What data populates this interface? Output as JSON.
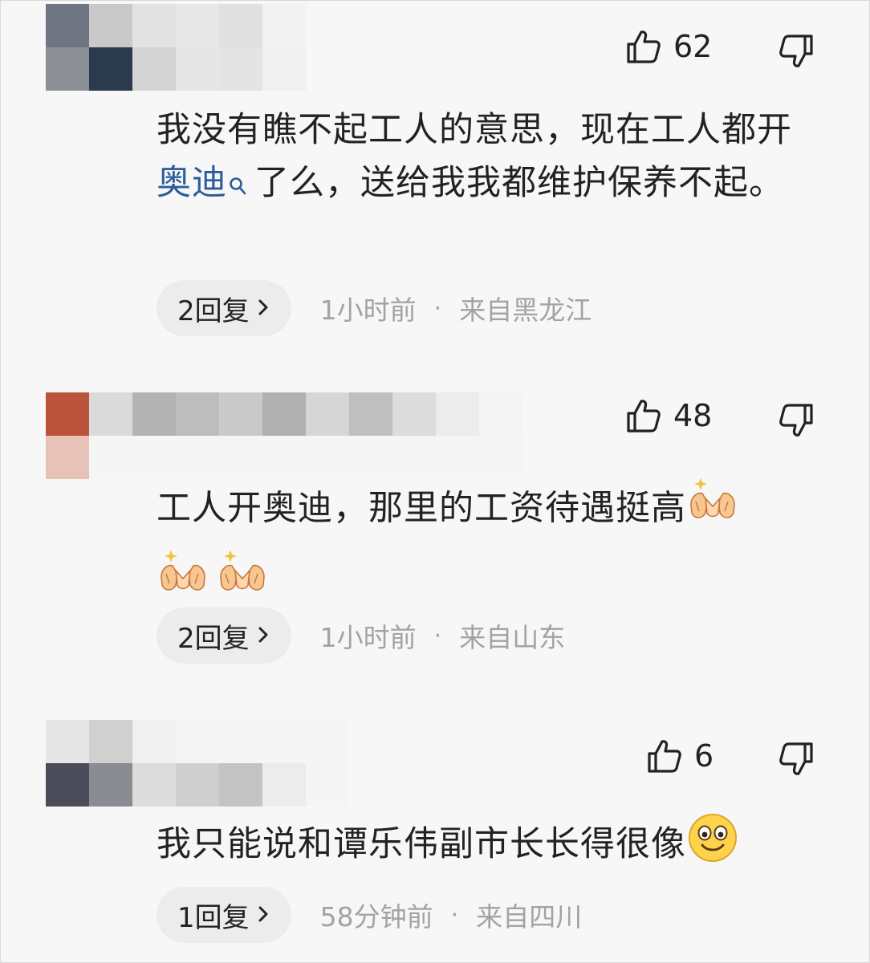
{
  "comments": [
    {
      "likes": "62",
      "text_before_link": "我没有瞧不起工人的意思，现在工人都开",
      "link_text": "奥迪",
      "text_after_link": "了么，送给我我都维护保养不起。",
      "reply_label": "2回复",
      "time": "1小时前",
      "separator": "·",
      "location": "来自黑龙江",
      "mosaic_colors": [
        "#6f7583",
        "#c9c9c9",
        "#e2e2e2",
        "#e8e8e8",
        "#e0e0e0",
        "#f2f2f2",
        "#8c8f96",
        "#2c3a4e",
        "#d4d4d4",
        "#e6e6e6",
        "#e4e4e4",
        "#f0f0f0"
      ]
    },
    {
      "likes": "48",
      "text": "工人开奥迪，那里的工资待遇挺高",
      "reply_label": "2回复",
      "time": "1小时前",
      "separator": "·",
      "location": "来自山东",
      "mosaic_colors": [
        "#b9543a",
        "#dadada",
        "#b3b3b3",
        "#bdbdbd",
        "#c9c9c9",
        "#b0b0b0",
        "#d6d6d6",
        "#bfbfbf",
        "#dcdcdc",
        "#ececec",
        "#f4f4f4",
        "#e7c2b6",
        "#f5f5f5",
        "#f5f5f5",
        "#f5f5f5",
        "#f5f5f5",
        "#f5f5f5",
        "#f5f5f5",
        "#f5f5f5",
        "#f5f5f5",
        "#f5f5f5",
        "#f5f5f5"
      ]
    },
    {
      "likes": "6",
      "text": "我只能说和谭乐伟副市长长得很像",
      "reply_label": "1回复",
      "time": "58分钟前",
      "separator": "·",
      "location": "来自四川",
      "mosaic_colors": [
        "#e6e6e6",
        "#d0d0d0",
        "#f0f0f0",
        "#f4f4f4",
        "#f5f5f5",
        "#f5f5f5",
        "#f5f5f5",
        "#4b4e5a",
        "#8b8c91",
        "#dcdcdc",
        "#cfcfcf",
        "#c4c4c4",
        "#ececec",
        "#f5f5f5"
      ]
    }
  ],
  "icons": {
    "like": "thumbs-up-outline",
    "dislike": "thumbs-down-outline",
    "search": "search-magnifier",
    "clap": "clapping-hands-emoji",
    "smile": "smiling-face-emoji",
    "chevron": "chevron-right"
  }
}
